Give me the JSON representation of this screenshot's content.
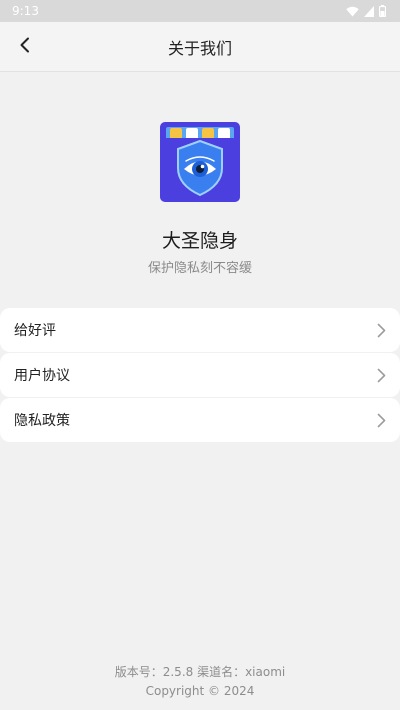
{
  "status_bar": {
    "time": "9:13",
    "icons": [
      "wifi-icon",
      "signal-icon",
      "battery-icon"
    ]
  },
  "header": {
    "title": "关于我们",
    "back_icon": "chevron-left-icon"
  },
  "app": {
    "name": "大圣隐身",
    "slogan": "保护隐私刻不容缓",
    "logo_icon": "shield-eye-logo"
  },
  "menu": {
    "items": [
      {
        "label": "给好评",
        "icon": "chevron-right-icon"
      },
      {
        "label": "用户协议",
        "icon": "chevron-right-icon"
      },
      {
        "label": "隐私政策",
        "icon": "chevron-right-icon"
      }
    ]
  },
  "footer": {
    "version": "版本号：2.5.8 渠道名：xiaomi",
    "copyright": "Copyright © 2024"
  },
  "colors": {
    "background": "#f1f1f1",
    "logo_bg": "#4b3fe0",
    "shield": "#3a7ff0"
  }
}
